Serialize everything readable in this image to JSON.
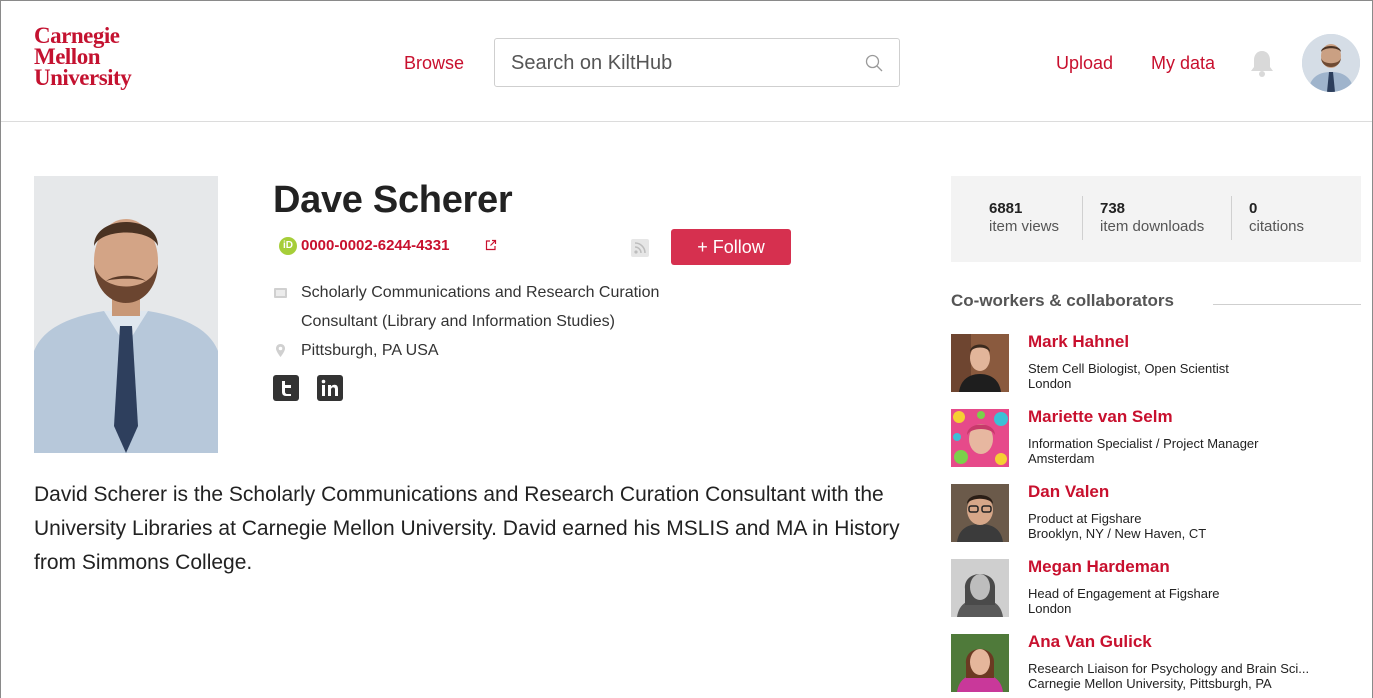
{
  "header": {
    "logo_line1": "Carnegie",
    "logo_line2": "Mellon",
    "logo_line3": "University",
    "browse_label": "Browse",
    "search_placeholder": "Search on KiltHub",
    "upload_label": "Upload",
    "mydata_label": "My data"
  },
  "profile": {
    "name": "Dave Scherer",
    "orcid": "0000-0002-6244-4331",
    "follow_label": "+ Follow",
    "position_line1": "Scholarly Communications and Research Curation",
    "position_line2": "Consultant (Library and Information Studies)",
    "location": "Pittsburgh, PA USA",
    "bio": "David Scherer is the Scholarly Communications and Research Curation Consultant with the University Libraries at Carnegie Mellon University. David earned his MSLIS and MA in History from Simmons College."
  },
  "stats": [
    {
      "value": "6881",
      "label": "item views"
    },
    {
      "value": "738",
      "label": "item downloads"
    },
    {
      "value": "0",
      "label": "citations"
    }
  ],
  "coworkers": {
    "title": "Co-workers & collaborators",
    "items": [
      {
        "name": "Mark Hahnel",
        "role": "Stem Cell Biologist, Open Scientist",
        "location": "London"
      },
      {
        "name": "Mariette van Selm",
        "role": "Information Specialist / Project Manager",
        "location": "Amsterdam"
      },
      {
        "name": "Dan Valen",
        "role": "Product at Figshare",
        "location": "Brooklyn, NY / New Haven, CT"
      },
      {
        "name": "Megan Hardeman",
        "role": "Head of Engagement at Figshare",
        "location": "London"
      },
      {
        "name": "Ana Van Gulick",
        "role": "Research Liaison for Psychology and Brain Sci...",
        "location": "Carnegie Mellon University, Pittsburgh, PA"
      }
    ]
  },
  "colors": {
    "brand": "#c41230",
    "accent": "#c8102e",
    "follow_button": "#d6304f",
    "orcid": "#a6ce39"
  }
}
